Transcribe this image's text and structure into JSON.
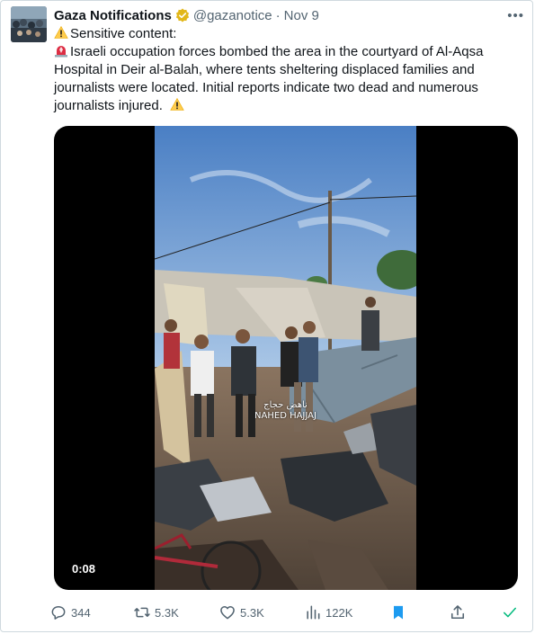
{
  "tweet": {
    "author_name": "Gaza Notifications",
    "handle": "@gazanotice",
    "separator": "·",
    "date": "Nov 9",
    "more_label": "•••",
    "text_lines": [
      "Sensitive content:",
      "Israeli occupation forces bombed the area in the courtyard of Al-Aqsa",
      "Hospital in Deir al-Balah, where tents sheltering displaced families and",
      "journalists were located. Initial reports indicate two dead and numerous",
      "journalists injured."
    ],
    "video": {
      "duration": "0:08",
      "watermark_arabic": "ناهض حجاج",
      "watermark_latin": "NAHED HAJJAJ"
    },
    "actions": {
      "replies": "344",
      "retweets": "5.3K",
      "likes": "5.3K",
      "views": "122K"
    }
  },
  "colors": {
    "text": "#0f1419",
    "secondary": "#536471",
    "bookmark_active": "#1d9bf0",
    "verified_badge": "#e2b719",
    "check_green": "#00ba7c"
  },
  "icons": [
    "warning-icon",
    "siren-icon",
    "verified-badge-icon",
    "more-icon",
    "reply-icon",
    "retweet-icon",
    "like-icon",
    "views-icon",
    "bookmark-icon",
    "share-icon",
    "check-icon"
  ]
}
